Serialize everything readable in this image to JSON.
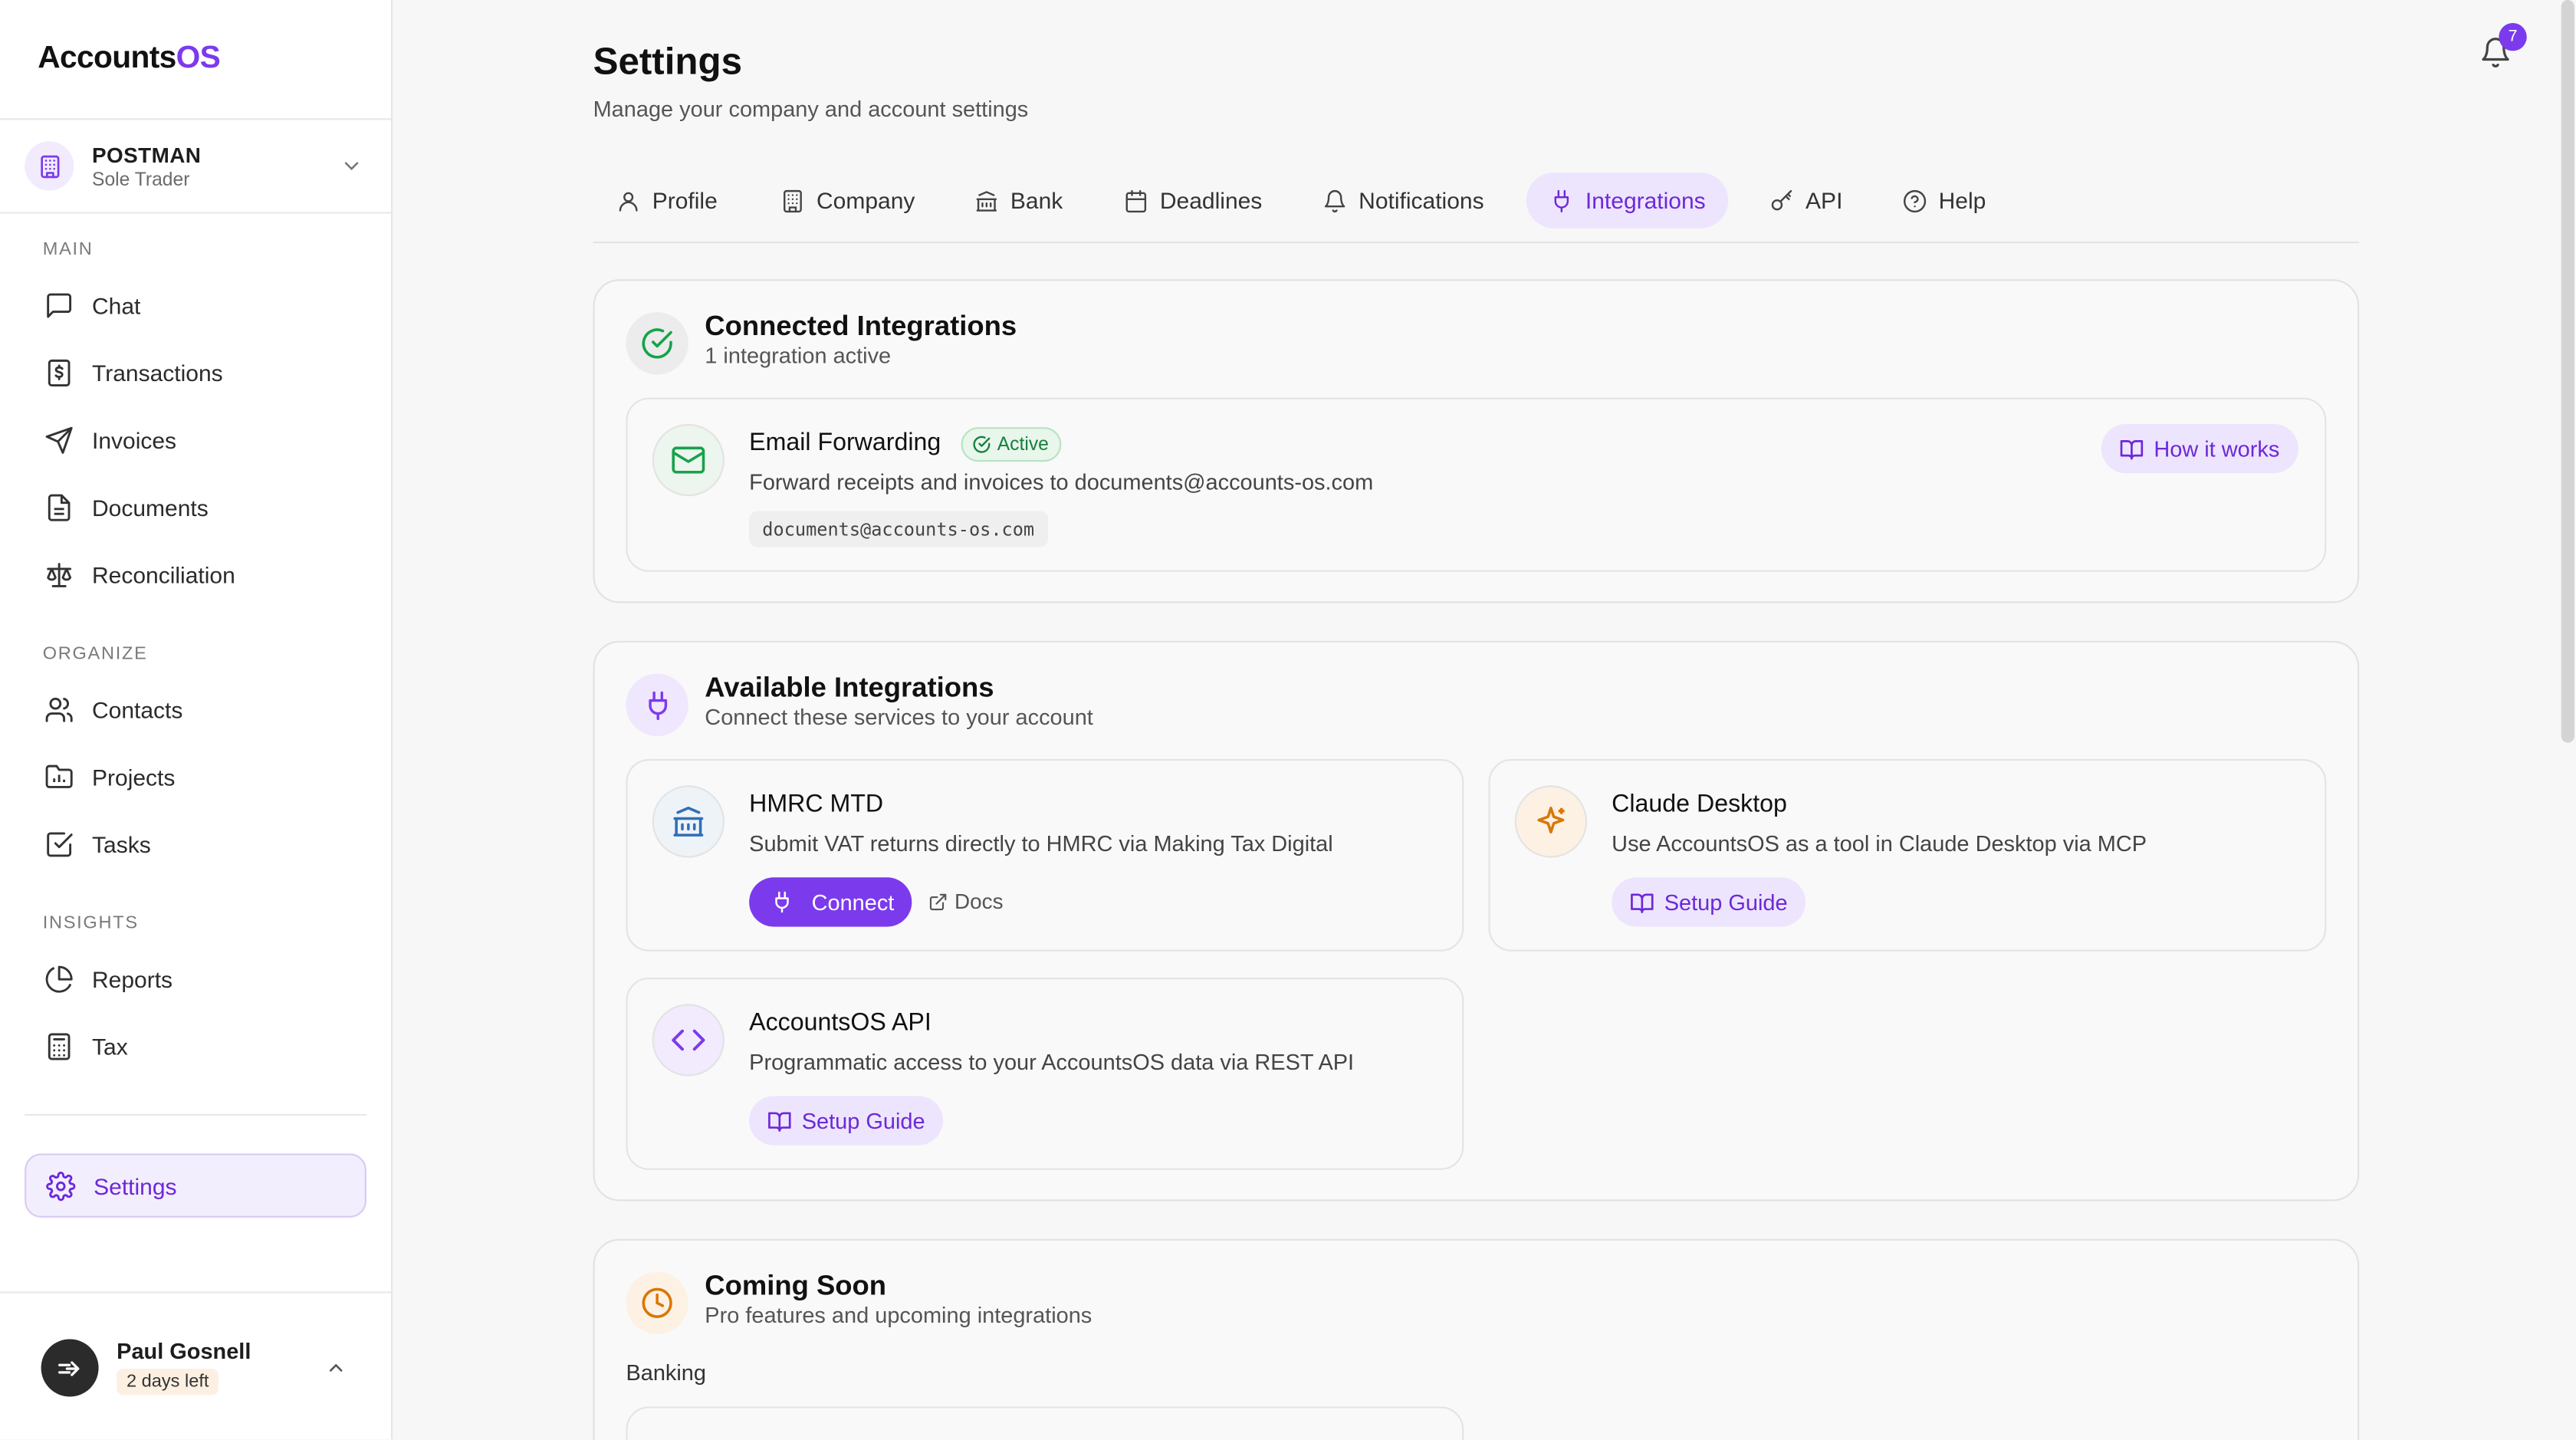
{
  "app": {
    "logo_main": "Accounts",
    "logo_accent": "OS",
    "accent": "#7c3aed"
  },
  "company": {
    "name": "POSTMAN",
    "type": "Sole Trader"
  },
  "sidebar": {
    "main_label": "MAIN",
    "main_items": [
      {
        "label": "Chat",
        "icon": "chat-icon"
      },
      {
        "label": "Transactions",
        "icon": "receipt-icon"
      },
      {
        "label": "Invoices",
        "icon": "send-icon"
      },
      {
        "label": "Documents",
        "icon": "document-icon"
      },
      {
        "label": "Reconciliation",
        "icon": "scale-icon"
      }
    ],
    "organize_label": "ORGANIZE",
    "organize_items": [
      {
        "label": "Contacts",
        "icon": "users-icon"
      },
      {
        "label": "Projects",
        "icon": "chart-folder-icon"
      },
      {
        "label": "Tasks",
        "icon": "checkbox-icon"
      }
    ],
    "insights_label": "INSIGHTS",
    "insights_items": [
      {
        "label": "Reports",
        "icon": "pie-chart-icon"
      },
      {
        "label": "Tax",
        "icon": "calculator-icon"
      }
    ],
    "settings_label": "Settings"
  },
  "user": {
    "name": "Paul Gosnell",
    "trial": "2 days left"
  },
  "header": {
    "title": "Settings",
    "subtitle": "Manage your company and account settings",
    "notifications_count": "7"
  },
  "tabs": [
    {
      "label": "Profile",
      "icon": "user-icon"
    },
    {
      "label": "Company",
      "icon": "building-icon"
    },
    {
      "label": "Bank",
      "icon": "bank-icon"
    },
    {
      "label": "Deadlines",
      "icon": "calendar-icon"
    },
    {
      "label": "Notifications",
      "icon": "bell-icon"
    },
    {
      "label": "Integrations",
      "icon": "plug-icon",
      "active": true
    },
    {
      "label": "API",
      "icon": "key-icon"
    },
    {
      "label": "Help",
      "icon": "help-icon"
    }
  ],
  "connected": {
    "title": "Connected Integrations",
    "subtitle": "1 integration active",
    "email": {
      "title": "Email Forwarding",
      "status": "Active",
      "description": "Forward receipts and invoices to documents@accounts-os.com",
      "address": "documents@accounts-os.com",
      "action": "How it works"
    }
  },
  "available": {
    "title": "Available Integrations",
    "subtitle": "Connect these services to your account",
    "hmrc": {
      "title": "HMRC MTD",
      "description": "Submit VAT returns directly to HMRC via Making Tax Digital",
      "connect": "Connect",
      "docs": "Docs"
    },
    "claude": {
      "title": "Claude Desktop",
      "description": "Use AccountsOS as a tool in Claude Desktop via MCP",
      "action": "Setup Guide"
    },
    "api": {
      "title": "AccountsOS API",
      "description": "Programmatic access to your AccountsOS data via REST API",
      "action": "Setup Guide"
    }
  },
  "coming_soon": {
    "title": "Coming Soon",
    "subtitle": "Pro features and upcoming integrations",
    "group": "Banking"
  }
}
